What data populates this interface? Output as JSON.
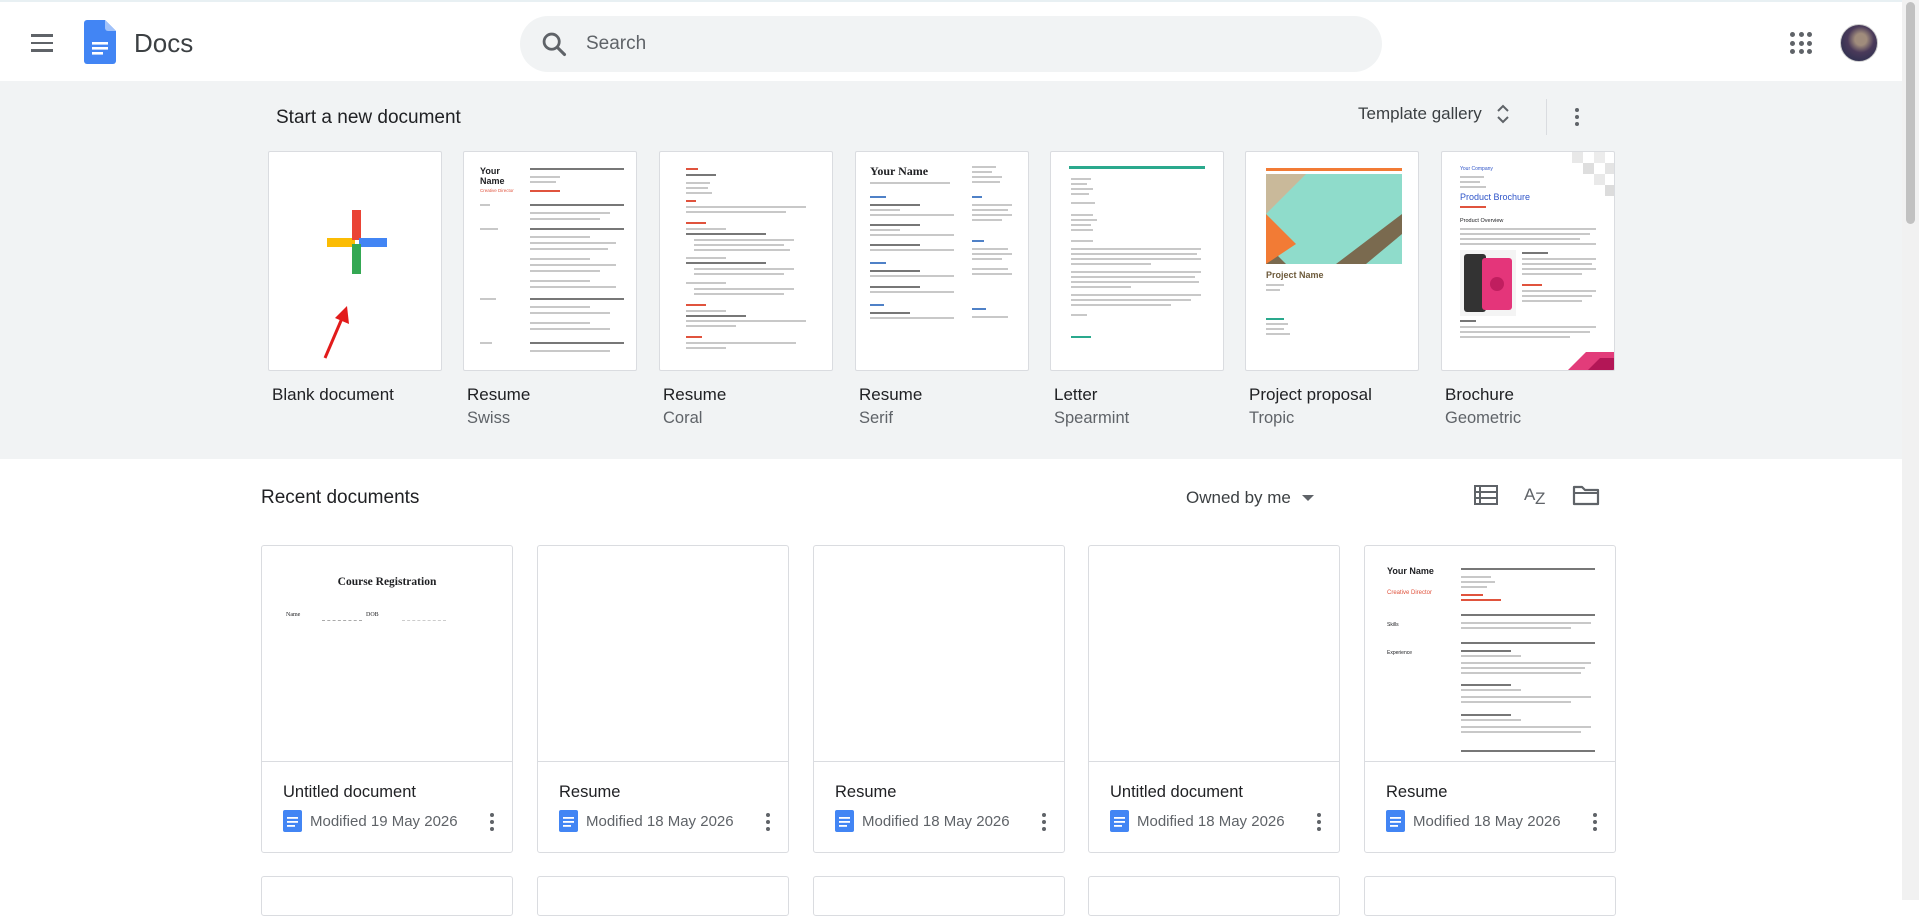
{
  "header": {
    "app_title": "Docs",
    "search_placeholder": "Search"
  },
  "templates": {
    "section_title": "Start a new document",
    "gallery_label": "Template gallery",
    "items": [
      {
        "name": "Blank document",
        "subtitle": ""
      },
      {
        "name": "Resume",
        "subtitle": "Swiss"
      },
      {
        "name": "Resume",
        "subtitle": "Coral"
      },
      {
        "name": "Resume",
        "subtitle": "Serif"
      },
      {
        "name": "Letter",
        "subtitle": "Spearmint"
      },
      {
        "name": "Project proposal",
        "subtitle": "Tropic"
      },
      {
        "name": "Brochure",
        "subtitle": "Geometric"
      }
    ],
    "thumb_text": {
      "swiss_name": "Your Name",
      "swiss_role": "Creative Director",
      "serif_name": "Your Name",
      "tropic_title": "Project Name",
      "brochure_company": "Your Company",
      "brochure_title": "Product Brochure",
      "brochure_overview": "Product Overview"
    }
  },
  "recent": {
    "section_title": "Recent documents",
    "owner_filter": "Owned by me",
    "docs": [
      {
        "title": "Untitled document",
        "modified": "Modified 19 May 2026",
        "thumb_title": "Course Registration",
        "thumb_label": "Name",
        "thumb_label2": "DOB"
      },
      {
        "title": "Resume",
        "modified": "Modified 18 May 2026"
      },
      {
        "title": "Resume",
        "modified": "Modified 18 May 2026"
      },
      {
        "title": "Untitled document",
        "modified": "Modified 18 May 2026"
      },
      {
        "title": "Resume",
        "modified": "Modified 18 May 2026",
        "thumb_name": "Your Name",
        "thumb_role": "Creative Director",
        "thumb_skills": "Skills",
        "thumb_experience": "Experience"
      }
    ]
  },
  "colors": {
    "docs_blue": "#4285f4",
    "plus_red": "#ea4335",
    "plus_yellow": "#fbbc04",
    "plus_green": "#34a853",
    "plus_blue": "#4285f4",
    "annotation_arrow": "#e21b1b"
  }
}
